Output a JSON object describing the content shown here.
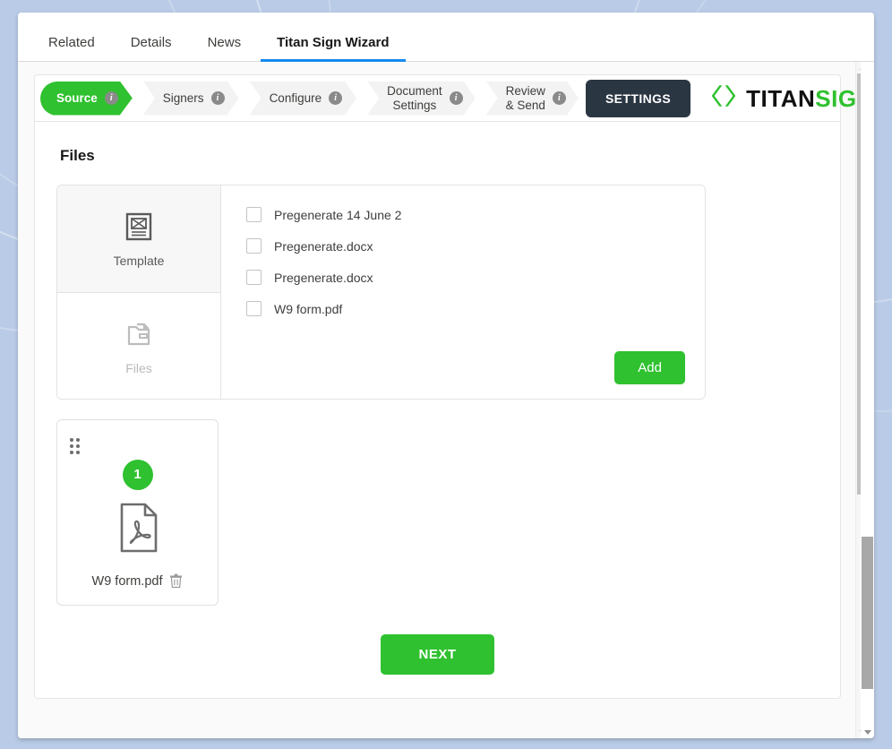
{
  "tabs": [
    {
      "label": "Related",
      "active": false
    },
    {
      "label": "Details",
      "active": false
    },
    {
      "label": "News",
      "active": false
    },
    {
      "label": "Titan Sign Wizard",
      "active": true
    }
  ],
  "wizard": {
    "steps": [
      {
        "label": "Source",
        "line1": "Source",
        "line2": "",
        "active": true,
        "info": "i"
      },
      {
        "label": "Signers",
        "line1": "Signers",
        "line2": "",
        "active": false,
        "info": "i"
      },
      {
        "label": "Configure",
        "line1": "Configure",
        "line2": "",
        "active": false,
        "info": "i"
      },
      {
        "label": "Document Settings",
        "line1": "Document",
        "line2": "Settings",
        "active": false,
        "info": "i"
      },
      {
        "label": "Review & Send",
        "line1": "Review",
        "line2": "& Send",
        "active": false,
        "info": "i"
      }
    ],
    "settings_label": "SETTINGS",
    "brand": {
      "name_part1": "TITAN",
      "name_part2": "SIGN",
      "logo_icon": "titan-chevron-logo"
    }
  },
  "panel": {
    "title": "Files",
    "source_tabs": [
      {
        "label": "Template",
        "icon": "template-icon",
        "active": true
      },
      {
        "label": "Files",
        "icon": "folder-files-icon",
        "active": false
      }
    ],
    "file_options": [
      {
        "name": "Pregenerate 14 June 2",
        "checked": false
      },
      {
        "name": "Pregenerate.docx",
        "checked": false
      },
      {
        "name": "Pregenerate.docx",
        "checked": false
      },
      {
        "name": "W9 form.pdf",
        "checked": false
      }
    ],
    "add_label": "Add",
    "documents": [
      {
        "order": "1",
        "name": "W9 form.pdf",
        "icon": "pdf-file-icon",
        "delete_icon": "trash-icon",
        "drag_icon": "drag-handle-icon"
      }
    ]
  },
  "footer": {
    "next_label": "NEXT"
  },
  "colors": {
    "accent_green": "#2fc12f",
    "settings_dark": "#2b3643",
    "tab_active_underline": "#1589ee",
    "page_background": "#b9cbe6"
  }
}
